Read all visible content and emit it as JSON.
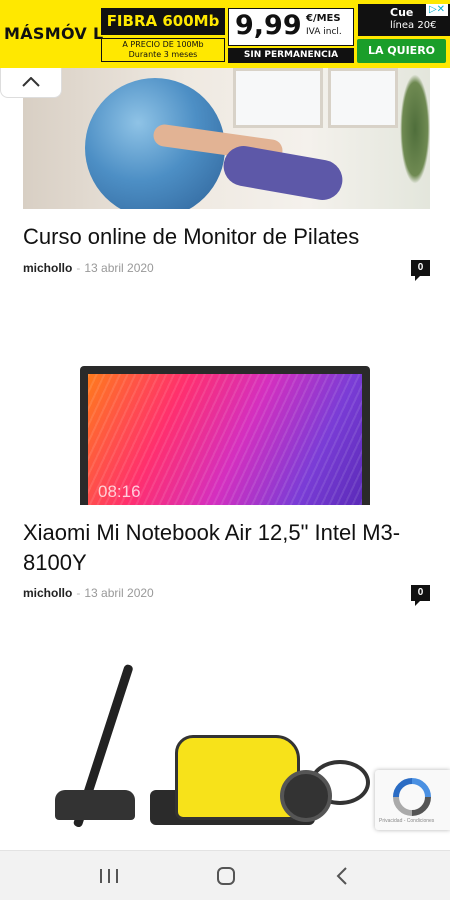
{
  "ad": {
    "brand": "MÁSMÓV L",
    "fibra": "FIBRA 600Mb",
    "precio_line1": "A PRECIO DE 100Mb",
    "precio_line2": "Durante 3 meses",
    "price": "9,99",
    "price_unit": "€/MES",
    "price_iva": "IVA incl.",
    "sin_permanencia": "SIN PERMANENCIA",
    "side_line1": "Cue",
    "side_line2": "línea 20€",
    "cta": "LA QUIERO",
    "colors": {
      "background": "#ffe800",
      "cta": "#1a9e2a"
    }
  },
  "collapse": {
    "icon": "chevron-up-icon"
  },
  "articles": [
    {
      "title": "Curso online de Monitor de Pilates",
      "author": "michollo",
      "date": "13 abril 2020",
      "comments": "0"
    },
    {
      "title": "Xiaomi Mi Notebook Air 12,5\" Intel M3-8100Y",
      "author": "michollo",
      "date": "13 abril 2020",
      "comments": "0",
      "screen_time": "08:16"
    },
    {
      "title": "",
      "author": "",
      "date": "",
      "comments": ""
    }
  ],
  "recaptcha": {
    "footer": "Privacidad - Condiciones"
  },
  "navbar": {
    "recent_icon": "recent-apps-icon",
    "home_icon": "home-icon",
    "back_icon": "back-icon"
  }
}
